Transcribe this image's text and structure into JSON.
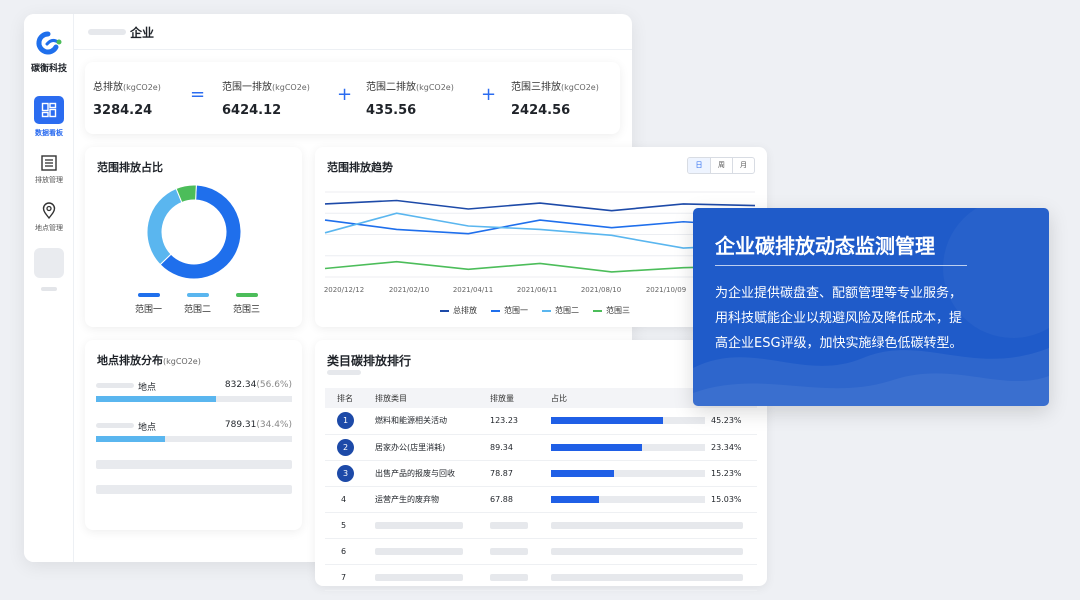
{
  "sidebar": {
    "brand": "碳衡科技",
    "items": [
      {
        "label": "数据看板",
        "icon": "dashboard-icon",
        "active": true
      },
      {
        "label": "排放管理",
        "icon": "list-icon",
        "active": false
      },
      {
        "label": "地点管理",
        "icon": "location-pin-icon",
        "active": false
      }
    ]
  },
  "topbar": {
    "title": "企业"
  },
  "kpis": [
    {
      "label": "总排放",
      "unit": "(kgCO2e)",
      "value": "3284.24"
    },
    {
      "label": "范围一排放",
      "unit": "(kgCO2e)",
      "value": "6424.12"
    },
    {
      "label": "范围二排放",
      "unit": "(kgCO2e)",
      "value": "435.56"
    },
    {
      "label": "范围三排放",
      "unit": "(kgCO2e)",
      "value": "2424.56"
    }
  ],
  "operators": [
    "=",
    "+",
    "+"
  ],
  "scope_share": {
    "title": "范围排放占比",
    "legend": [
      "范围一",
      "范围二",
      "范围三"
    ]
  },
  "trend": {
    "title": "范围排放趋势",
    "period_tabs": [
      "日",
      "周",
      "月"
    ],
    "legend": [
      "总排放",
      "范围一",
      "范围二",
      "范围三"
    ]
  },
  "location": {
    "title": "地点排放分布",
    "unit": "(kgCO2e)",
    "rows": [
      {
        "name": "地点",
        "value": "832.34",
        "pct": "(56.6%)",
        "ratio": 0.61
      },
      {
        "name": "地点",
        "value": "789.31",
        "pct": "(34.4%)",
        "ratio": 0.35
      }
    ]
  },
  "ranking": {
    "title": "类目碳排放排行",
    "headers": [
      "排名",
      "排放类目",
      "排放量",
      "占比"
    ],
    "rows": [
      {
        "rank": "1",
        "category": "燃料和能源相关活动",
        "amount": "123.23",
        "share": "45.23%",
        "ratio": 0.73
      },
      {
        "rank": "2",
        "category": "居家办公(店里消耗)",
        "amount": "89.34",
        "share": "23.34%",
        "ratio": 0.59
      },
      {
        "rank": "3",
        "category": "出售产品的报废与回收",
        "amount": "78.87",
        "share": "15.23%",
        "ratio": 0.41
      },
      {
        "rank": "4",
        "category": "运营产生的废弃物",
        "amount": "67.88",
        "share": "15.03%",
        "ratio": 0.31
      },
      {
        "rank": "5"
      },
      {
        "rank": "6"
      },
      {
        "rank": "7"
      }
    ]
  },
  "promo": {
    "headline": "企业碳排放动态监测管理",
    "lines": [
      "为企业提供碳盘查、配额管理等专业服务，",
      "用科技赋能企业以规避风险及降低成本，提",
      "高企业ESG评级，加快实施绿色低碳转型。"
    ]
  },
  "colors": {
    "primary": "#2b6cf0",
    "scope1": "#1f6fec",
    "scope2": "#5ab6ef",
    "scope3": "#4cbd5a",
    "total": "#1d4aa8",
    "promo_bg": "#1f5bc9"
  },
  "chart_data": [
    {
      "type": "pie",
      "title": "范围排放占比",
      "labels": [
        "范围一",
        "范围二",
        "范围三"
      ],
      "values": [
        62,
        31,
        7
      ]
    },
    {
      "type": "line",
      "title": "范围排放趋势",
      "x": [
        "2020/12/12",
        "2021/02/10",
        "2021/04/11",
        "2021/06/11",
        "2021/08/10",
        "2021/10/09"
      ],
      "ylim": [
        0,
        100
      ],
      "series": [
        {
          "name": "总排放",
          "values": [
            86,
            90,
            80,
            87,
            78,
            86,
            84
          ]
        },
        {
          "name": "范围一",
          "values": [
            67,
            56,
            51,
            67,
            58,
            65,
            60
          ]
        },
        {
          "name": "范围二",
          "values": [
            52,
            75,
            60,
            56,
            49,
            34,
            38
          ]
        },
        {
          "name": "范围三",
          "values": [
            10,
            18,
            9,
            16,
            6,
            11,
            13
          ]
        }
      ]
    }
  ]
}
